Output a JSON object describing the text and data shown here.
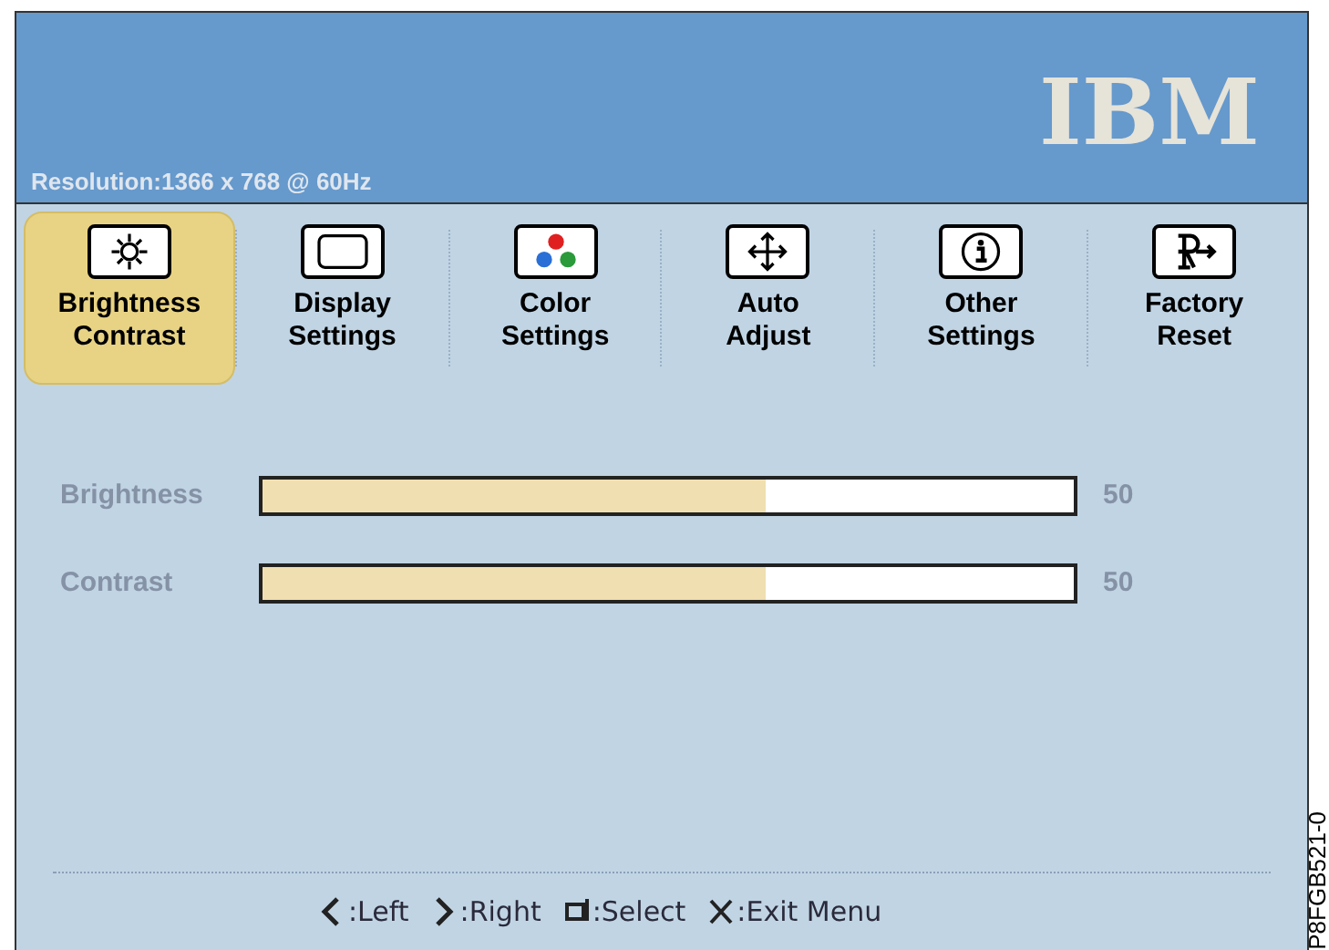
{
  "header": {
    "resolution": "Resolution:1366 x 768 @ 60Hz",
    "logo": "IBM"
  },
  "tabs": [
    {
      "kind": "brightness",
      "label": "Brightness Contrast",
      "selected": true
    },
    {
      "kind": "display",
      "label": "Display Settings",
      "selected": false
    },
    {
      "kind": "color",
      "label": "Color Settings",
      "selected": false
    },
    {
      "kind": "auto",
      "label": "Auto Adjust",
      "selected": false
    },
    {
      "kind": "info",
      "label": "Other Settings",
      "selected": false
    },
    {
      "kind": "reset",
      "label": "Factory Reset",
      "selected": false
    }
  ],
  "sliders": [
    {
      "label": "Brightness",
      "level": 0.62,
      "reading": "50"
    },
    {
      "label": "Contrast",
      "level": 0.62,
      "reading": "50"
    }
  ],
  "hints": [
    {
      "kind": "left",
      "text": ":Left"
    },
    {
      "kind": "right",
      "text": ":Right"
    },
    {
      "kind": "select",
      "text": ":Select"
    },
    {
      "kind": "exit",
      "text": ":Exit Menu"
    }
  ],
  "figure_label": "P8FGB521-0"
}
